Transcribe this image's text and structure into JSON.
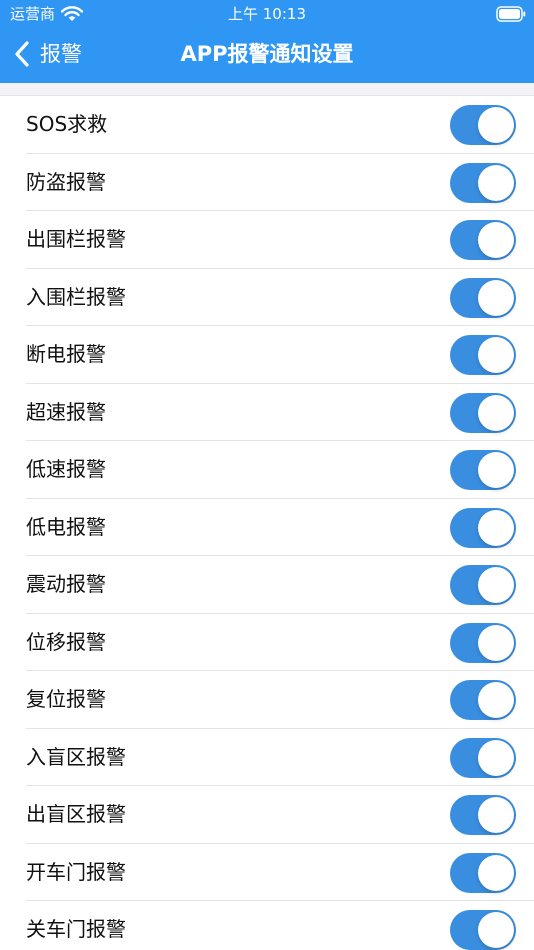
{
  "status_bar": {
    "carrier": "运营商",
    "time": "上午 10:13",
    "wifi_icon": "wifi-icon",
    "battery_icon": "battery-icon"
  },
  "nav": {
    "back_icon": "chevron-left-icon",
    "back_label": "报警",
    "title": "APP报警通知设置"
  },
  "colors": {
    "header_bg": "#2f96f3",
    "toggle_on": "#3a8ee0",
    "separator": "#e3e3e6",
    "gap_bg": "#f2f2f7"
  },
  "alarms": [
    {
      "label": "SOS求救",
      "enabled": true
    },
    {
      "label": "防盗报警",
      "enabled": true
    },
    {
      "label": "出围栏报警",
      "enabled": true
    },
    {
      "label": "入围栏报警",
      "enabled": true
    },
    {
      "label": "断电报警",
      "enabled": true
    },
    {
      "label": "超速报警",
      "enabled": true
    },
    {
      "label": "低速报警",
      "enabled": true
    },
    {
      "label": "低电报警",
      "enabled": true
    },
    {
      "label": "震动报警",
      "enabled": true
    },
    {
      "label": "位移报警",
      "enabled": true
    },
    {
      "label": "复位报警",
      "enabled": true
    },
    {
      "label": "入盲区报警",
      "enabled": true
    },
    {
      "label": "出盲区报警",
      "enabled": true
    },
    {
      "label": "开车门报警",
      "enabled": true
    },
    {
      "label": "关车门报警",
      "enabled": true
    }
  ]
}
